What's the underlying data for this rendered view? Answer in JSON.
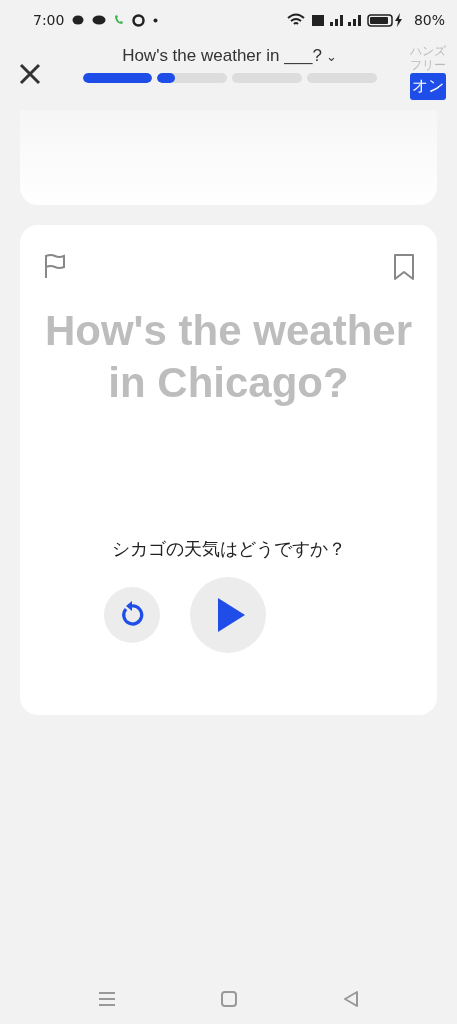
{
  "status_bar": {
    "time": "7:00",
    "battery": "80%"
  },
  "header": {
    "title": "How's the weather in ___?",
    "title_caret": "⌄",
    "hands_free": {
      "label": "ハンズフリー",
      "toggle": "オン",
      "on": true
    },
    "progress": [
      {
        "level": 1
      },
      {
        "level": 0.25
      },
      {
        "level": 0
      },
      {
        "level": 0
      }
    ]
  },
  "card": {
    "phrase": "How's the weather in Chicago?",
    "translation": "シカゴの天気はどうですか？"
  }
}
